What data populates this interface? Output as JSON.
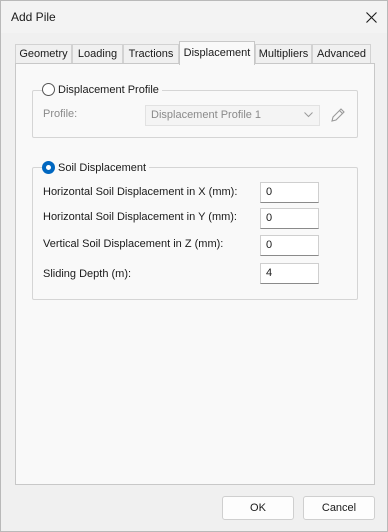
{
  "window": {
    "title": "Add Pile"
  },
  "tabs": [
    {
      "label": "Geometry"
    },
    {
      "label": "Loading"
    },
    {
      "label": "Tractions"
    },
    {
      "label": "Displacement"
    },
    {
      "label": "Multipliers"
    },
    {
      "label": "Advanced"
    }
  ],
  "active_tab": "Displacement",
  "displacement_profile": {
    "label": "Displacement Profile",
    "selected": false,
    "profile_label": "Profile:",
    "profile_value": "Displacement Profile 1",
    "enabled": false
  },
  "soil_displacement": {
    "label": "Soil Displacement",
    "selected": true,
    "fields": [
      {
        "label": "Horizontal Soil Displacement in X (mm):",
        "value": "0"
      },
      {
        "label": "Horizontal Soil Displacement in Y (mm):",
        "value": "0"
      },
      {
        "label": "Vertical Soil Displacement in Z (mm):",
        "value": "0"
      },
      {
        "label": "Sliding Depth (m):",
        "value": "4"
      }
    ]
  },
  "buttons": {
    "ok": "OK",
    "cancel": "Cancel"
  },
  "icons": {
    "close": "close-icon",
    "chevron": "chevron-down-icon",
    "edit": "pencil-icon"
  },
  "colors": {
    "accent": "#0067c0"
  }
}
